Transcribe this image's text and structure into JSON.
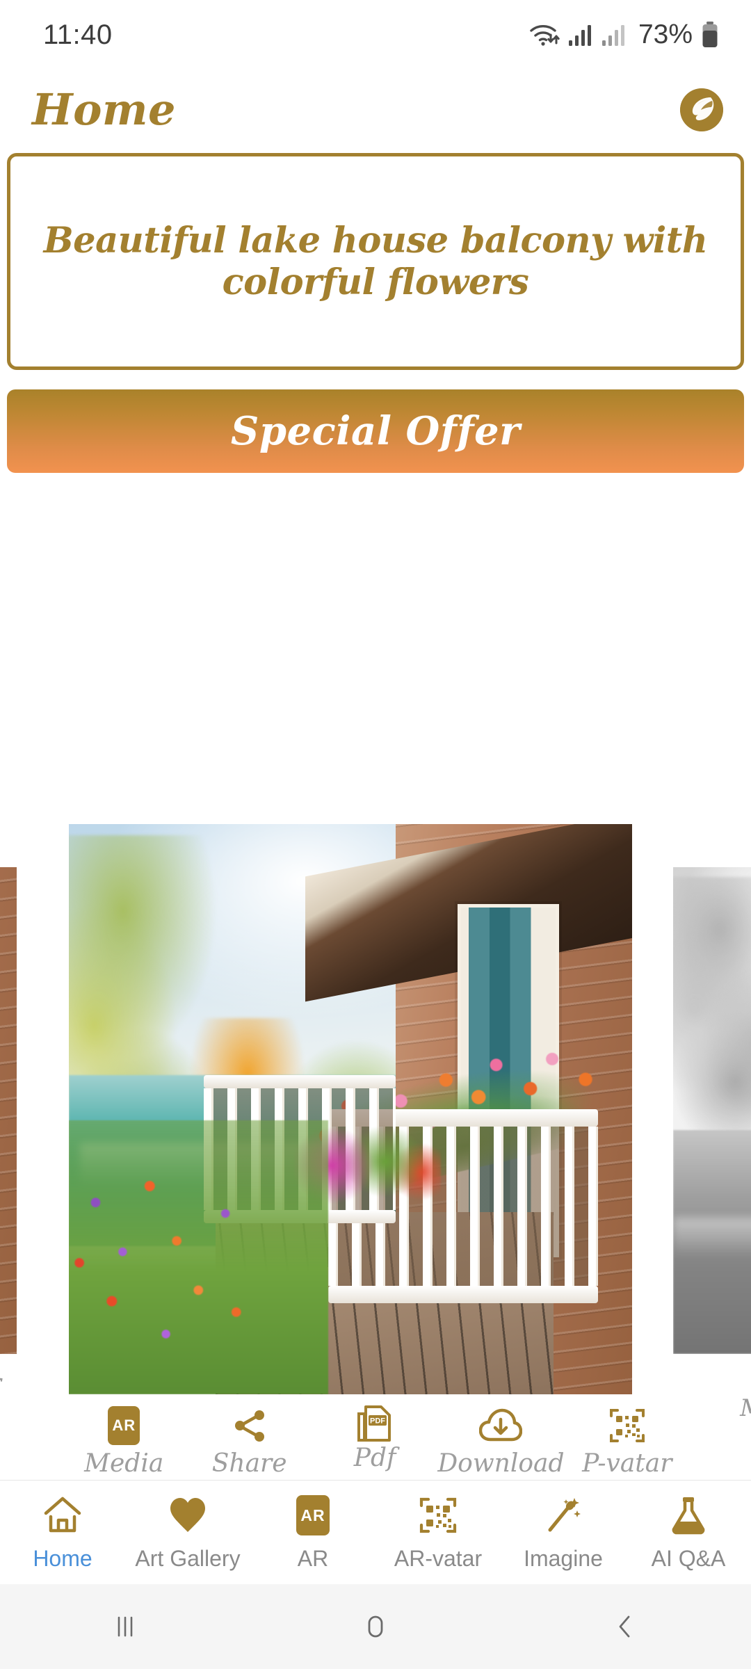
{
  "status_bar": {
    "time": "11:40",
    "battery_percent": "73%",
    "icons": [
      "wifi-icon",
      "signal-icon",
      "signal-icon",
      "battery-icon"
    ]
  },
  "header": {
    "title": "Home",
    "logo": "app-logo-icon"
  },
  "prompt_card": {
    "text": "Beautiful lake house balcony with colorful flowers"
  },
  "offer_button": {
    "label": "Special Offer"
  },
  "carousel": {
    "slides": [
      {
        "id": "prev",
        "caption": "ar",
        "icon": "ar-chip-icon",
        "alt": "lake house siding and balcony post"
      },
      {
        "id": "current",
        "caption": "",
        "icon": "",
        "alt": "Beautiful lake house balcony with colorful flowers"
      },
      {
        "id": "next",
        "caption": "Media",
        "icon": "ar-chip-icon",
        "alt": "grayscale lake and forest reflection"
      }
    ]
  },
  "actions": [
    {
      "label": "Media",
      "icon": "ar-chip-icon"
    },
    {
      "label": "Share",
      "icon": "share-icon"
    },
    {
      "label": "Pdf",
      "icon": "pdf-icon"
    },
    {
      "label": "Download",
      "icon": "download-cloud-icon"
    },
    {
      "label": "P-vatar",
      "icon": "qr-code-icon"
    }
  ],
  "bottom_nav": {
    "items": [
      {
        "label": "Home",
        "icon": "house-icon",
        "active": true
      },
      {
        "label": "Art Gallery",
        "icon": "heart-icon",
        "active": false
      },
      {
        "label": "AR",
        "icon": "ar-chip-icon",
        "active": false
      },
      {
        "label": "AR-vatar",
        "icon": "qr-code-icon",
        "active": false
      },
      {
        "label": "Imagine",
        "icon": "magic-wand-icon",
        "active": false
      },
      {
        "label": "AI Q&A",
        "icon": "flask-icon",
        "active": false
      }
    ]
  },
  "android_nav": {
    "buttons": [
      "recents-icon",
      "home-icon",
      "back-icon"
    ]
  },
  "colors": {
    "gold": "#A3802F",
    "offer_gradient_top": "#A9822A",
    "offer_gradient_bottom": "#F2924F",
    "active_blue": "#4A90D9",
    "caption_gray": "#9E9E9E"
  }
}
